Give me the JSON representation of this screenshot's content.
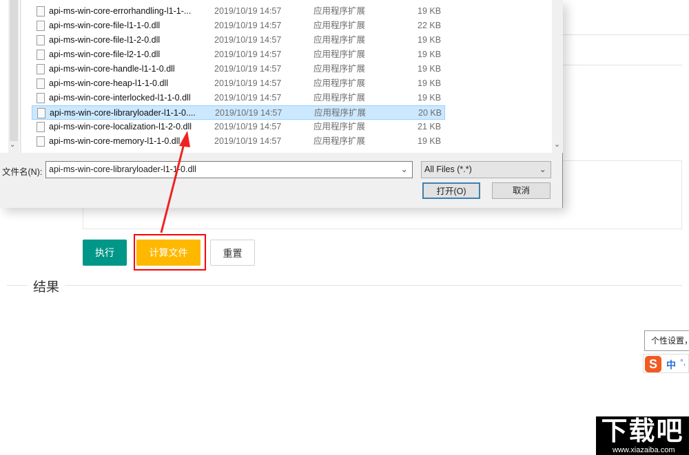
{
  "page": {
    "buttons": {
      "execute": "执行",
      "compute_file": "计算文件",
      "reset": "重置"
    },
    "result_legend": "结果",
    "colors": {
      "execute": "#009688",
      "compute_file": "#FFB800",
      "highlight": "#ff0000"
    }
  },
  "dialog": {
    "files": [
      {
        "name": "api-ms-win-core-errorhandling-l1-1-...",
        "date": "2019/10/19 14:57",
        "type": "应用程序扩展",
        "size": "19 KB"
      },
      {
        "name": "api-ms-win-core-file-l1-1-0.dll",
        "date": "2019/10/19 14:57",
        "type": "应用程序扩展",
        "size": "22 KB"
      },
      {
        "name": "api-ms-win-core-file-l1-2-0.dll",
        "date": "2019/10/19 14:57",
        "type": "应用程序扩展",
        "size": "19 KB"
      },
      {
        "name": "api-ms-win-core-file-l2-1-0.dll",
        "date": "2019/10/19 14:57",
        "type": "应用程序扩展",
        "size": "19 KB"
      },
      {
        "name": "api-ms-win-core-handle-l1-1-0.dll",
        "date": "2019/10/19 14:57",
        "type": "应用程序扩展",
        "size": "19 KB"
      },
      {
        "name": "api-ms-win-core-heap-l1-1-0.dll",
        "date": "2019/10/19 14:57",
        "type": "应用程序扩展",
        "size": "19 KB"
      },
      {
        "name": "api-ms-win-core-interlocked-l1-1-0.dll",
        "date": "2019/10/19 14:57",
        "type": "应用程序扩展",
        "size": "19 KB"
      },
      {
        "name": "api-ms-win-core-libraryloader-l1-1-0....",
        "date": "2019/10/19 14:57",
        "type": "应用程序扩展",
        "size": "20 KB",
        "selected": true
      },
      {
        "name": "api-ms-win-core-localization-l1-2-0.dll",
        "date": "2019/10/19 14:57",
        "type": "应用程序扩展",
        "size": "21 KB"
      },
      {
        "name": "api-ms-win-core-memory-l1-1-0.dll",
        "date": "2019/10/19 14:57",
        "type": "应用程序扩展",
        "size": "19 KB"
      }
    ],
    "filename_label": "文件名(N):",
    "filename_value": "api-ms-win-core-libraryloader-l1-1-0.dll",
    "filter_value": "All Files (*.*)",
    "open_button": "打开(O)",
    "cancel_button": "取消"
  },
  "ime": {
    "tooltip": "个性设置，",
    "mode": "中"
  },
  "watermark": {
    "logo": "下载吧",
    "url": "www.xiazaiba.com"
  }
}
